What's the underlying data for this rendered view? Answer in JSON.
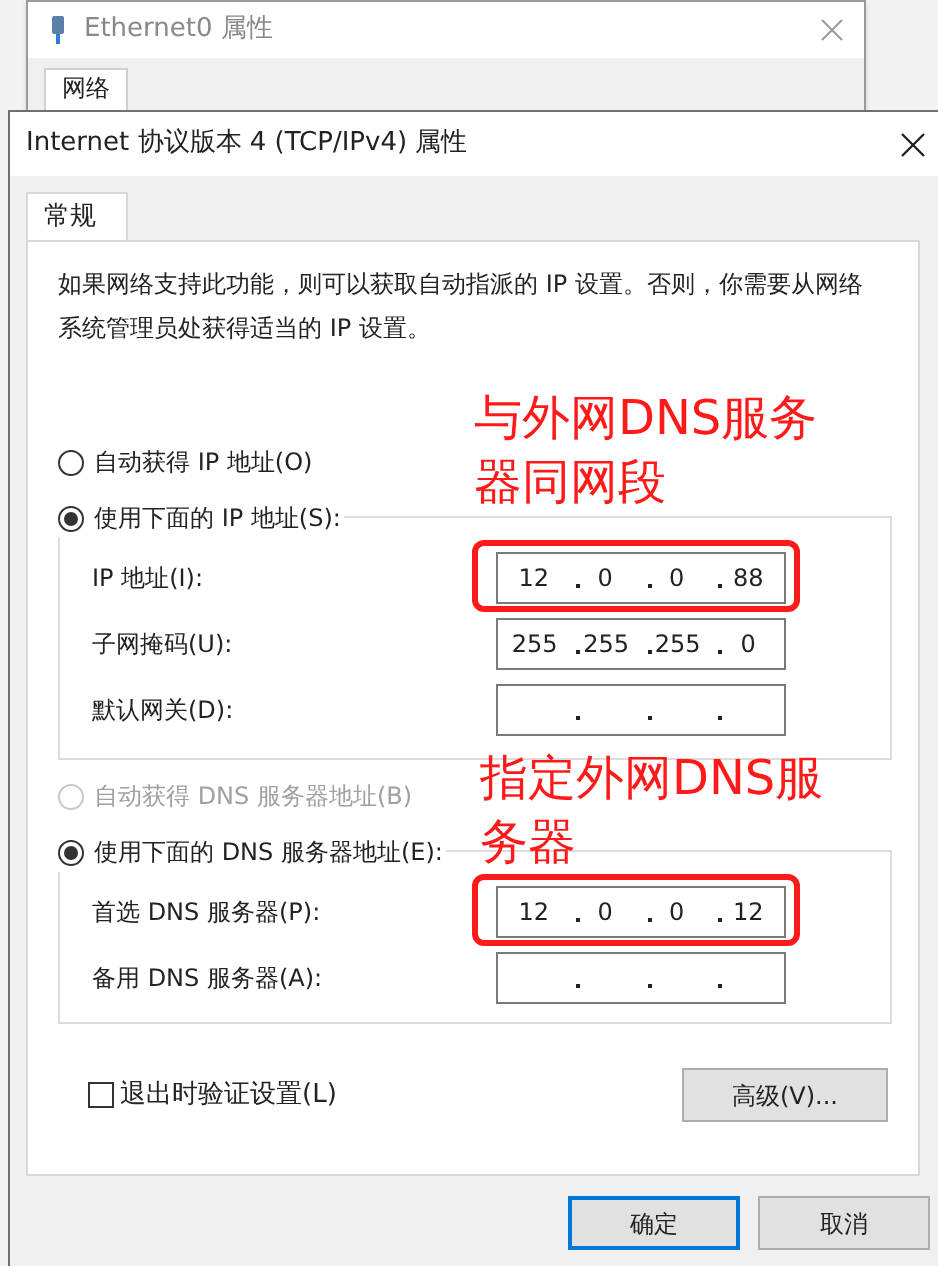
{
  "background_window": {
    "title": "Ethernet0 属性",
    "tabs": [
      {
        "label": "网络",
        "selected": true
      }
    ]
  },
  "dialog": {
    "title": "Internet 协议版本 4 (TCP/IPv4) 属性",
    "tabs": [
      {
        "label": "常规",
        "selected": true
      }
    ],
    "description": "如果网络支持此功能，则可以获取自动指派的 IP 设置。否则，你需要从网络系统管理员处获得适当的 IP 设置。",
    "ip_mode": [
      {
        "label": "自动获得 IP 地址(O)",
        "selected": false,
        "disabled": false
      },
      {
        "label": "使用下面的 IP 地址(S):",
        "selected": true,
        "disabled": false
      }
    ],
    "ip_fields": [
      {
        "label": "IP 地址(I):",
        "octets": [
          "12",
          "0",
          "0",
          "88"
        ],
        "highlighted": true
      },
      {
        "label": "子网掩码(U):",
        "octets": [
          "255",
          "255",
          "255",
          "0"
        ],
        "highlighted": false
      },
      {
        "label": "默认网关(D):",
        "highlighted": false
      }
    ],
    "dns_mode": [
      {
        "label": "自动获得 DNS 服务器地址(B)",
        "selected": false,
        "disabled": true
      },
      {
        "label": "使用下面的 DNS 服务器地址(E):",
        "selected": true,
        "disabled": false
      }
    ],
    "dns_fields": [
      {
        "label": "首选 DNS 服务器(P):",
        "octets": [
          "12",
          "0",
          "0",
          "12"
        ],
        "highlighted": true
      },
      {
        "label": "备用 DNS 服务器(A):",
        "highlighted": false
      }
    ],
    "validate_on_exit": {
      "label": "退出时验证设置(L)",
      "checked": false
    },
    "advanced_button": "高级(V)...",
    "buttons": [
      {
        "label": "确定",
        "default": true
      },
      {
        "label": "取消",
        "default": false
      }
    ]
  },
  "annotations": [
    "与外网DNS服务器同网段",
    "指定外网DNS服务器"
  ]
}
